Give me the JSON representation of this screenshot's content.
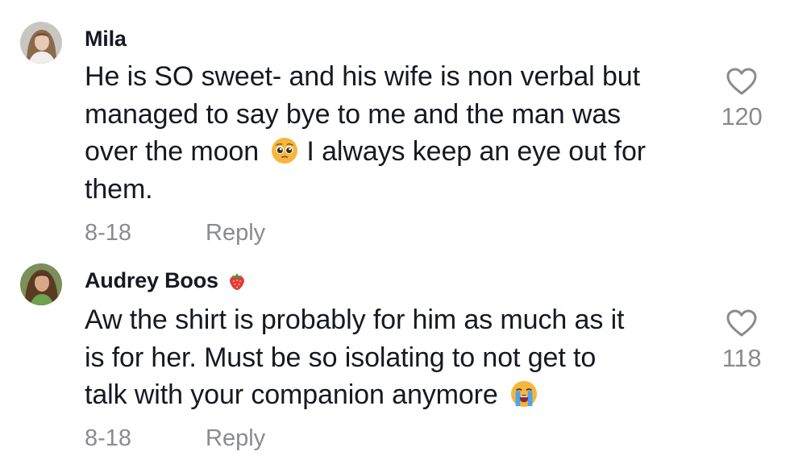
{
  "comments": [
    {
      "username": "Mila",
      "lines": [
        "He is SO sweet- and his wife is non verbal but",
        "managed to say bye to me and the man was",
        "over the moon",
        "I always keep an eye out for",
        "them."
      ],
      "emoji": "pleading-face",
      "date": "8-18",
      "reply_label": "Reply",
      "like_count": "120"
    },
    {
      "username": "Audrey Boos",
      "badge": "strawberry",
      "lines": [
        "Aw the shirt is probably for him as much as it",
        "is for her. Must be so isolating to not get to",
        "talk with your companion anymore"
      ],
      "emoji": "loudly-crying-face",
      "date": "8-18",
      "reply_label": "Reply",
      "like_count": "118"
    }
  ],
  "icons": {
    "like": "heart-outline-icon",
    "pleading": "pleading-face-emoji",
    "crying": "loudly-crying-face-emoji",
    "badge": "strawberry-icon"
  },
  "colors": {
    "text": "#161823",
    "secondary": "#8a8b91",
    "emoji_yellow": "#f7b63c"
  }
}
